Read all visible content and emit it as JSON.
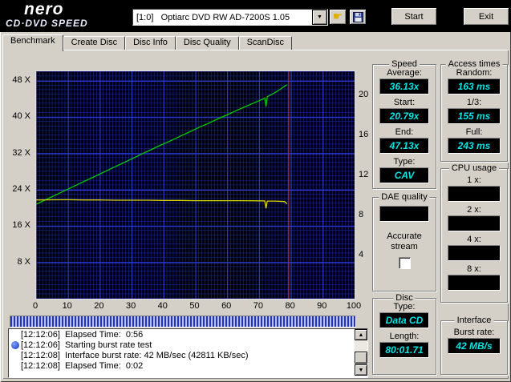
{
  "header": {
    "logo_line1": "nero",
    "logo_line2": "CD·DVD SPEED",
    "drive_selector_value": "[1:0]   Optiarc DVD RW AD-7200S 1.05",
    "start_button": "Start",
    "exit_button": "Exit"
  },
  "icons": {
    "hand_tool_glyph": "☛",
    "combo_arrow": "▼",
    "scroll_up": "▲",
    "scroll_down": "▼"
  },
  "tabs": [
    "Benchmark",
    "Create Disc",
    "Disc Info",
    "Disc Quality",
    "ScanDisc"
  ],
  "active_tab": "Benchmark",
  "colors": {
    "window_bg": "#d4d0c8",
    "lcd_bg": "#000000",
    "lcd_text": "#00e5e5",
    "chart_bg": "#000010",
    "grid_fine": "#1c2cb4",
    "grid_major": "#3040d8",
    "read_curve": "#00cc00",
    "spindle_curve": "#d8d800",
    "end_marker": "#cc2020"
  },
  "chart_data": {
    "type": "line",
    "title": "",
    "xlabel": "",
    "ylabel": "",
    "x_axis": {
      "min": 0,
      "max": 100,
      "ticks": [
        0,
        10,
        20,
        30,
        40,
        50,
        60,
        70,
        80,
        90,
        100
      ]
    },
    "y_axis_left": {
      "min": 0,
      "max": 50.1,
      "unit": "X",
      "ticks": [
        48,
        40,
        32,
        24,
        16,
        8
      ]
    },
    "y_axis_right": {
      "min": -0.32,
      "max": 22.4,
      "ticks": [
        20,
        16,
        12,
        8,
        4
      ]
    },
    "grid": true,
    "series": [
      {
        "name": "read speed",
        "color": "#00cc00",
        "points": [
          [
            0,
            20.79
          ],
          [
            3,
            21.8
          ],
          [
            6,
            22.8
          ],
          [
            9,
            23.8
          ],
          [
            12,
            24.8
          ],
          [
            15,
            25.8
          ],
          [
            18,
            26.8
          ],
          [
            21,
            27.8
          ],
          [
            24,
            28.8
          ],
          [
            27,
            29.8
          ],
          [
            30,
            30.8
          ],
          [
            33,
            31.8
          ],
          [
            36,
            32.8
          ],
          [
            39,
            33.8
          ],
          [
            42,
            34.7
          ],
          [
            45,
            35.7
          ],
          [
            48,
            36.7
          ],
          [
            51,
            37.7
          ],
          [
            54,
            38.6
          ],
          [
            57,
            39.6
          ],
          [
            60,
            40.5
          ],
          [
            63,
            41.5
          ],
          [
            66,
            42.4
          ],
          [
            68,
            43.0
          ],
          [
            70,
            43.6
          ],
          [
            71.3,
            44.0
          ],
          [
            71.8,
            44.2
          ],
          [
            72.2,
            42.3
          ],
          [
            72.6,
            44.5
          ],
          [
            74,
            45.0
          ],
          [
            75.5,
            45.6
          ],
          [
            77,
            46.3
          ],
          [
            78,
            46.8
          ],
          [
            78.8,
            47.13
          ]
        ]
      },
      {
        "name": "spindle speed",
        "color": "#d8d800",
        "points": [
          [
            0,
            21.75
          ],
          [
            5,
            21.78
          ],
          [
            10,
            21.8
          ],
          [
            15,
            21.75
          ],
          [
            20,
            21.75
          ],
          [
            25,
            21.7
          ],
          [
            30,
            21.7
          ],
          [
            35,
            21.7
          ],
          [
            40,
            21.65
          ],
          [
            45,
            21.65
          ],
          [
            50,
            21.6
          ],
          [
            55,
            21.6
          ],
          [
            60,
            21.6
          ],
          [
            65,
            21.6
          ],
          [
            70,
            21.55
          ],
          [
            71.8,
            21.55
          ],
          [
            72.2,
            19.9
          ],
          [
            72.6,
            21.5
          ],
          [
            75,
            21.5
          ],
          [
            78,
            21.4
          ],
          [
            78.8,
            20.9
          ]
        ]
      }
    ],
    "end_marker": {
      "x": 79.3,
      "color": "#cc2020"
    }
  },
  "panels": {
    "speed": {
      "title": "Speed",
      "rows": [
        {
          "label": "Average:",
          "value": "36.13x"
        },
        {
          "label": "Start:",
          "value": "20.79x"
        },
        {
          "label": "End:",
          "value": "47.13x"
        },
        {
          "label": "Type:",
          "value": "CAV"
        }
      ]
    },
    "access_times": {
      "title": "Access times",
      "rows": [
        {
          "label": "Random:",
          "value": "163 ms"
        },
        {
          "label": "1/3:",
          "value": "155 ms"
        },
        {
          "label": "Full:",
          "value": "243 ms"
        }
      ]
    },
    "dae_quality": {
      "title": "DAE quality",
      "display_value": "",
      "checkbox_label": "Accurate stream",
      "checkbox_checked": false
    },
    "cpu_usage": {
      "title": "CPU usage",
      "rows": [
        {
          "label": "1 x:",
          "value": ""
        },
        {
          "label": "2 x:",
          "value": ""
        },
        {
          "label": "4 x:",
          "value": ""
        },
        {
          "label": "8 x:",
          "value": ""
        }
      ]
    },
    "disc": {
      "title": "Disc",
      "rows": [
        {
          "label": "Type:",
          "value": "Data CD"
        },
        {
          "label": "Length:",
          "value": "80:01.71"
        }
      ]
    },
    "interface": {
      "title": "Interface",
      "rows": [
        {
          "label": "Burst rate:",
          "value": "42 MB/s"
        }
      ]
    }
  },
  "log": {
    "lines": [
      {
        "icon": false,
        "text": "[12:12:06]  Elapsed Time:  0:56"
      },
      {
        "icon": true,
        "text": "[12:12:06]  Starting burst rate test"
      },
      {
        "icon": false,
        "text": "[12:12:08]  Interface burst rate: 42 MB/sec (42811 KB/sec)"
      },
      {
        "icon": false,
        "text": "[12:12:08]  Elapsed Time:  0:02"
      }
    ]
  }
}
